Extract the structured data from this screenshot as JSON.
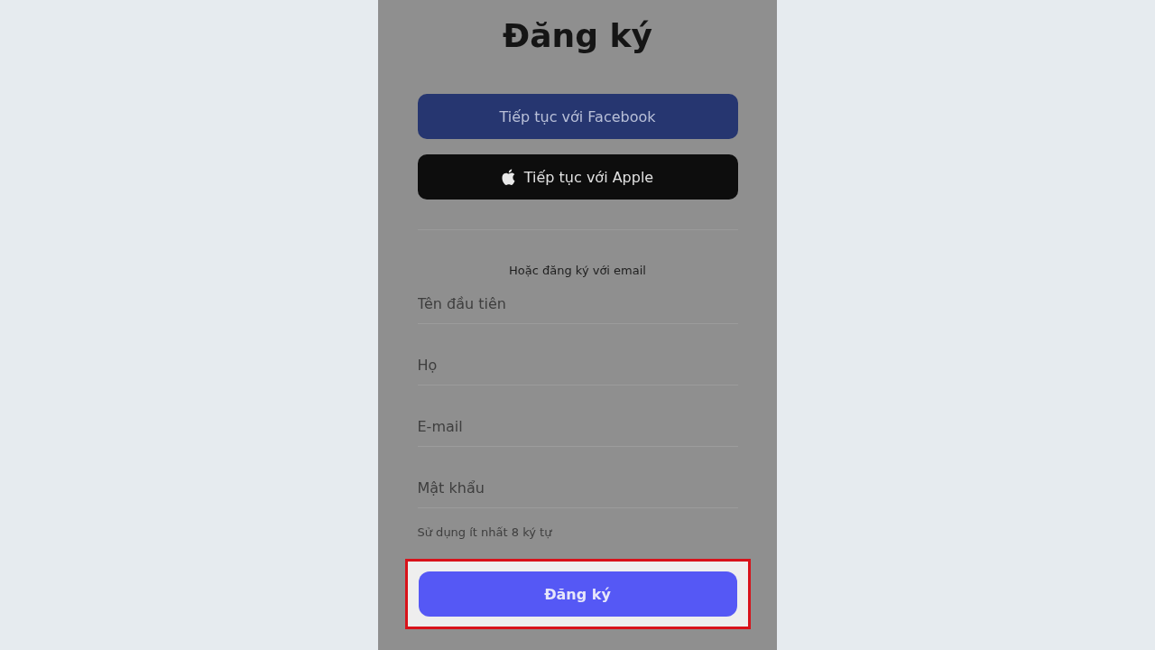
{
  "title": "Đăng ký",
  "social_buttons": [
    {
      "kind": "facebook",
      "label": "Tiếp tục với Facebook"
    },
    {
      "kind": "apple",
      "label": "Tiếp tục với Apple"
    }
  ],
  "separator_text": "Hoặc đăng ký với email",
  "fields": [
    {
      "placeholder": "Tên đầu tiên"
    },
    {
      "placeholder": "Họ"
    },
    {
      "placeholder": "E-mail"
    },
    {
      "placeholder": "Mật khẩu"
    }
  ],
  "password_hint": "Sử dụng ít nhất 8 ký tự",
  "submit": {
    "label": "Đăng ký",
    "highlighted": true
  }
}
